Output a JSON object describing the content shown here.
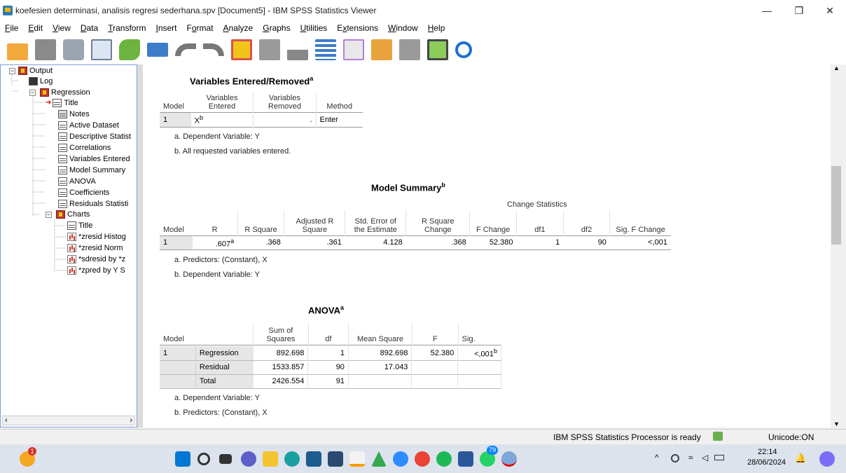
{
  "window": {
    "title": "koefesien determinasi, analisis regresi sederhana.spv [Document5] - IBM SPSS Statistics Viewer",
    "minimize": "—",
    "restore": "❐",
    "close": "✕"
  },
  "menu": [
    {
      "pre": "",
      "u": "F",
      "post": "ile"
    },
    {
      "pre": "",
      "u": "E",
      "post": "dit"
    },
    {
      "pre": "",
      "u": "V",
      "post": "iew"
    },
    {
      "pre": "",
      "u": "D",
      "post": "ata"
    },
    {
      "pre": "",
      "u": "T",
      "post": "ransform"
    },
    {
      "pre": "",
      "u": "I",
      "post": "nsert"
    },
    {
      "pre": "F",
      "u": "o",
      "post": "rmat"
    },
    {
      "pre": "",
      "u": "A",
      "post": "nalyze"
    },
    {
      "pre": "",
      "u": "G",
      "post": "raphs"
    },
    {
      "pre": "",
      "u": "U",
      "post": "tilities"
    },
    {
      "pre": "E",
      "u": "x",
      "post": "tensions"
    },
    {
      "pre": "",
      "u": "W",
      "post": "indow"
    },
    {
      "pre": "",
      "u": "H",
      "post": "elp"
    }
  ],
  "tree": {
    "output": "Output",
    "log": "Log",
    "regression": "Regression",
    "title": "Title",
    "notes": "Notes",
    "active_dataset": "Active Dataset",
    "descriptive": "Descriptive Statist",
    "correlations": "Correlations",
    "variables_entered": "Variables Entered",
    "model_summary": "Model Summary",
    "anova": "ANOVA",
    "coefficients": "Coefficients",
    "residuals": "Residuals Statisti",
    "charts": "Charts",
    "charts_title": "Title",
    "chart1": "*zresid Histog",
    "chart2": "*zresid Norm",
    "chart3": "*sdresid by *z",
    "chart4": "*zpred by Y S"
  },
  "ver": {
    "title": "Variables Entered/Removed",
    "sup": "a",
    "headers": {
      "model": "Model",
      "entered": "Variables Entered",
      "removed": "Variables Removed",
      "method": "Method"
    },
    "row": {
      "model": "1",
      "entered": "X",
      "entered_sup": "b",
      "removed": ".",
      "method": "Enter"
    },
    "foot_a": "a. Dependent Variable: Y",
    "foot_b": "b. All requested variables entered."
  },
  "ms": {
    "title": "Model Summary",
    "sup": "b",
    "change_stats": "Change Statistics",
    "headers": {
      "model": "Model",
      "r": "R",
      "rsq": "R Square",
      "adj": "Adjusted R Square",
      "se": "Std. Error of the Estimate",
      "rsqc": "R Square Change",
      "fc": "F Change",
      "df1": "df1",
      "df2": "df2",
      "sigf": "Sig. F Change"
    },
    "row": {
      "model": "1",
      "r": ".607",
      "r_sup": "a",
      "rsq": ".368",
      "adj": ".361",
      "se": "4.128",
      "rsqc": ".368",
      "fc": "52.380",
      "df1": "1",
      "df2": "90",
      "sigf": "<,001"
    },
    "foot_a": "a. Predictors: (Constant), X",
    "foot_b": "b. Dependent Variable: Y"
  },
  "anova": {
    "title": "ANOVA",
    "sup": "a",
    "headers": {
      "model": "Model",
      "ss": "Sum of Squares",
      "df": "df",
      "ms": "Mean Square",
      "f": "F",
      "sig": "Sig."
    },
    "model": "1",
    "rows": [
      {
        "label": "Regression",
        "ss": "892.698",
        "df": "1",
        "ms": "892.698",
        "f": "52.380",
        "sig": "<,001",
        "sig_sup": "b"
      },
      {
        "label": "Residual",
        "ss": "1533.857",
        "df": "90",
        "ms": "17.043",
        "f": "",
        "sig": ""
      },
      {
        "label": "Total",
        "ss": "2426.554",
        "df": "91",
        "ms": "",
        "f": "",
        "sig": ""
      }
    ],
    "foot_a": "a. Dependent Variable: Y",
    "foot_b": "b. Predictors: (Constant), X"
  },
  "status": {
    "processor": "IBM SPSS Statistics Processor is ready",
    "unicode": "Unicode:ON"
  },
  "taskbar": {
    "time": "22:14",
    "date": "28/06/2024",
    "badge": "79",
    "weather_badge": "1"
  }
}
